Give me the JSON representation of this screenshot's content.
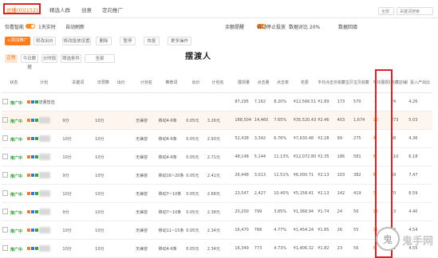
{
  "tabs": [
    {
      "label": "达播(0)(152)"
    },
    {
      "label": "精选人群"
    },
    {
      "label": "创意"
    },
    {
      "label": "定向推广"
    }
  ],
  "top_right": {
    "select": "全部",
    "search": "关键词搜索"
  },
  "row2": {
    "left1": "仅看智能",
    "left2": "1天实时",
    "left3": "自动刷新",
    "mid1": "余额提醒",
    "mid2": "自动停止投放",
    "right1": "数据对比 20%",
    "right2": "数据回填"
  },
  "actions": {
    "add": "+添加推广计划",
    "b2": "修改出价",
    "b3": "修改投放设置",
    "b4": "删除",
    "b5": "暂停",
    "b6": "恢复",
    "b7": "更多操作"
  },
  "filters": {
    "f1": "正常",
    "f2": "今日数据",
    "f3": "分时段",
    "f4": "筛选条件",
    "f5": "全部"
  },
  "watermark": "摆渡人",
  "headers": [
    "状态",
    "计划",
    "关键词",
    "日预算",
    "出价",
    "平均出价",
    "计划名",
    "推荐词",
    "出价",
    "计划名",
    "出价",
    "展现量",
    "点击量",
    "点击率",
    "花费",
    "平均点击花费",
    "收藏宝贝数",
    "宝贝收藏率",
    "加购数",
    "平均展现排名",
    "收藏店铺数",
    "投入产出比"
  ],
  "rows": [
    {
      "status": "推广中",
      "name": "流量智选",
      "budget": "",
      "bid": "",
      "p": "",
      "plan": "",
      "word": "",
      "c1": "",
      "c2": "",
      "c3": "",
      "imp": "87,295",
      "clk": "7,162",
      "ctr": "8.20%",
      "cost": "¥12,566.51",
      "cpc": "¥1.89",
      "fav": "173",
      "favr": "570",
      "cart": "",
      "rank": "-",
      "shop": "74",
      "roi": "4.26"
    },
    {
      "status": "推广中",
      "name": "",
      "budget": "9分",
      "bid": "10分",
      "p": "",
      "plan": "无兼容",
      "word": "移动4-6条",
      "c1": "0.05元",
      "c2": "3.26元",
      "c3": "",
      "imp": "188,504",
      "clk": "14,460",
      "ctr": "7.65%",
      "cost": "¥35,520.43",
      "cpc": "¥2.46",
      "fav": "403",
      "favr": "1,674",
      "cart": "",
      "rank": "10",
      "shop": "273",
      "roi": "5.03"
    },
    {
      "status": "推广中",
      "name": "",
      "budget": "10分",
      "bid": "10分",
      "p": "",
      "plan": "无兼容",
      "word": "移动4-6条",
      "c1": "0.05元",
      "c2": "2.93元",
      "c3": "",
      "imp": "52,438",
      "clk": "3,342",
      "ctr": "6.76%",
      "cost": "¥7,630.48",
      "cpc": "¥2.28",
      "fav": "99",
      "favr": "275",
      "cart": "",
      "rank": "4",
      "shop": "48",
      "roi": "4.36"
    },
    {
      "status": "推广中",
      "name": "",
      "budget": "10分",
      "bid": "10分",
      "p": "",
      "plan": "无兼容",
      "word": "移动4-6条",
      "c1": "0.05元",
      "c2": "2.71元",
      "c3": "",
      "imp": "48,148",
      "clk": "5,144",
      "ctr": "11.13%",
      "cost": "¥12,072.80",
      "cpc": "¥2.35",
      "fav": "186",
      "favr": "581",
      "cart": "",
      "rank": "5",
      "shop": "110",
      "roi": "6.18"
    },
    {
      "status": "推广中",
      "name": "",
      "budget": "9分",
      "bid": "10分",
      "p": "",
      "plan": "无兼容",
      "word": "移动16~20条",
      "c1": "0.05元",
      "c2": "2.41元",
      "c3": "",
      "imp": "26,448",
      "clk": "3,013",
      "ctr": "11.51%",
      "cost": "¥6,000.71",
      "cpc": "¥2.13",
      "fav": "103",
      "favr": "382",
      "cart": "",
      "rank": "8",
      "shop": "69",
      "roi": "7.47"
    },
    {
      "status": "推广中",
      "name": "",
      "budget": "10分",
      "bid": "10分",
      "p": "",
      "plan": "无兼容",
      "word": "移动7~10条",
      "c1": "0.05元",
      "c2": "2.68元",
      "c3": "",
      "imp": "23,547",
      "clk": "2,427",
      "ctr": "10.40%",
      "cost": "¥5,158.41",
      "cpc": "¥2.13",
      "fav": "142",
      "favr": "419",
      "cart": "",
      "rank": "7",
      "shop": "70",
      "roi": "8.59"
    },
    {
      "status": "推广中",
      "name": "",
      "budget": "9分",
      "bid": "10分",
      "p": "",
      "plan": "无兼容",
      "word": "移动7~10条",
      "c1": "0.05元",
      "c2": "2.38元",
      "c3": "",
      "imp": "20,200",
      "clk": "799",
      "ctr": "3.85%",
      "cost": "¥1,368.94",
      "cpc": "¥1.74",
      "fav": "24",
      "favr": "56",
      "cart": "",
      "rank": "13",
      "shop": "13",
      "roi": "4.40"
    },
    {
      "status": "推广中",
      "name": "",
      "budget": "10分",
      "bid": "10分",
      "p": "",
      "plan": "无兼容",
      "word": "移动11~15条",
      "c1": "0.05元",
      "c2": "2.34元",
      "c3": "",
      "imp": "16,470",
      "clk": "768",
      "ctr": "4.77%",
      "cost": "¥1,454.24",
      "cpc": "¥1.85",
      "fav": "26",
      "favr": "55",
      "cart": "",
      "rank": "11",
      "shop": "23",
      "roi": "4.54"
    },
    {
      "status": "推广中",
      "name": "",
      "budget": "10分",
      "bid": "10分",
      "p": "",
      "plan": "无兼容",
      "word": "移动4-6条",
      "c1": "0.05元",
      "c2": "2.34元",
      "c3": "",
      "imp": "16,349",
      "clk": "773",
      "ctr": "4.73%",
      "cost": "¥1,406.32",
      "cpc": "¥1.82",
      "fav": "23",
      "favr": "56",
      "cart": "",
      "rank": "5",
      "shop": "21",
      "roi": "4.55"
    }
  ],
  "logo_text": "鬼手网"
}
